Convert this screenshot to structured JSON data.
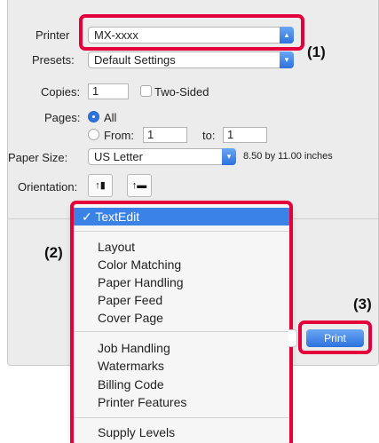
{
  "printer": {
    "label": "Printer",
    "value": "MX-xxxx"
  },
  "presets": {
    "label": "Presets:",
    "value": "Default Settings"
  },
  "copies": {
    "label": "Copies:",
    "value": "1",
    "two_sided_label": "Two-Sided",
    "two_sided_checked": false
  },
  "pages": {
    "label": "Pages:",
    "all_label": "All",
    "from_label": "From:",
    "from_value": "1",
    "to_label": "to:",
    "to_value": "1",
    "selected": "All"
  },
  "paper_size": {
    "label": "Paper Size:",
    "value": "US Letter",
    "dimensions": "8.50 by 11.00 inches"
  },
  "orientation": {
    "label": "Orientation:",
    "portrait_icon": "portrait-icon",
    "landscape_icon": "landscape-icon"
  },
  "menu": {
    "selected": "TextEdit",
    "check_glyph": "✓",
    "groups": [
      [
        "TextEdit"
      ],
      [
        "Layout",
        "Color Matching",
        "Paper Handling",
        "Paper Feed",
        "Cover Page"
      ],
      [
        "Job Handling",
        "Watermarks",
        "Billing Code",
        "Printer Features"
      ],
      [
        "Supply Levels"
      ]
    ]
  },
  "print_button": "Print",
  "callouts": {
    "c1": "(1)",
    "c2": "(2)",
    "c3": "(3)"
  },
  "colors": {
    "accent": "#2d72dd",
    "callout": "#e3003b",
    "menu_highlight": "#3b82e6"
  }
}
